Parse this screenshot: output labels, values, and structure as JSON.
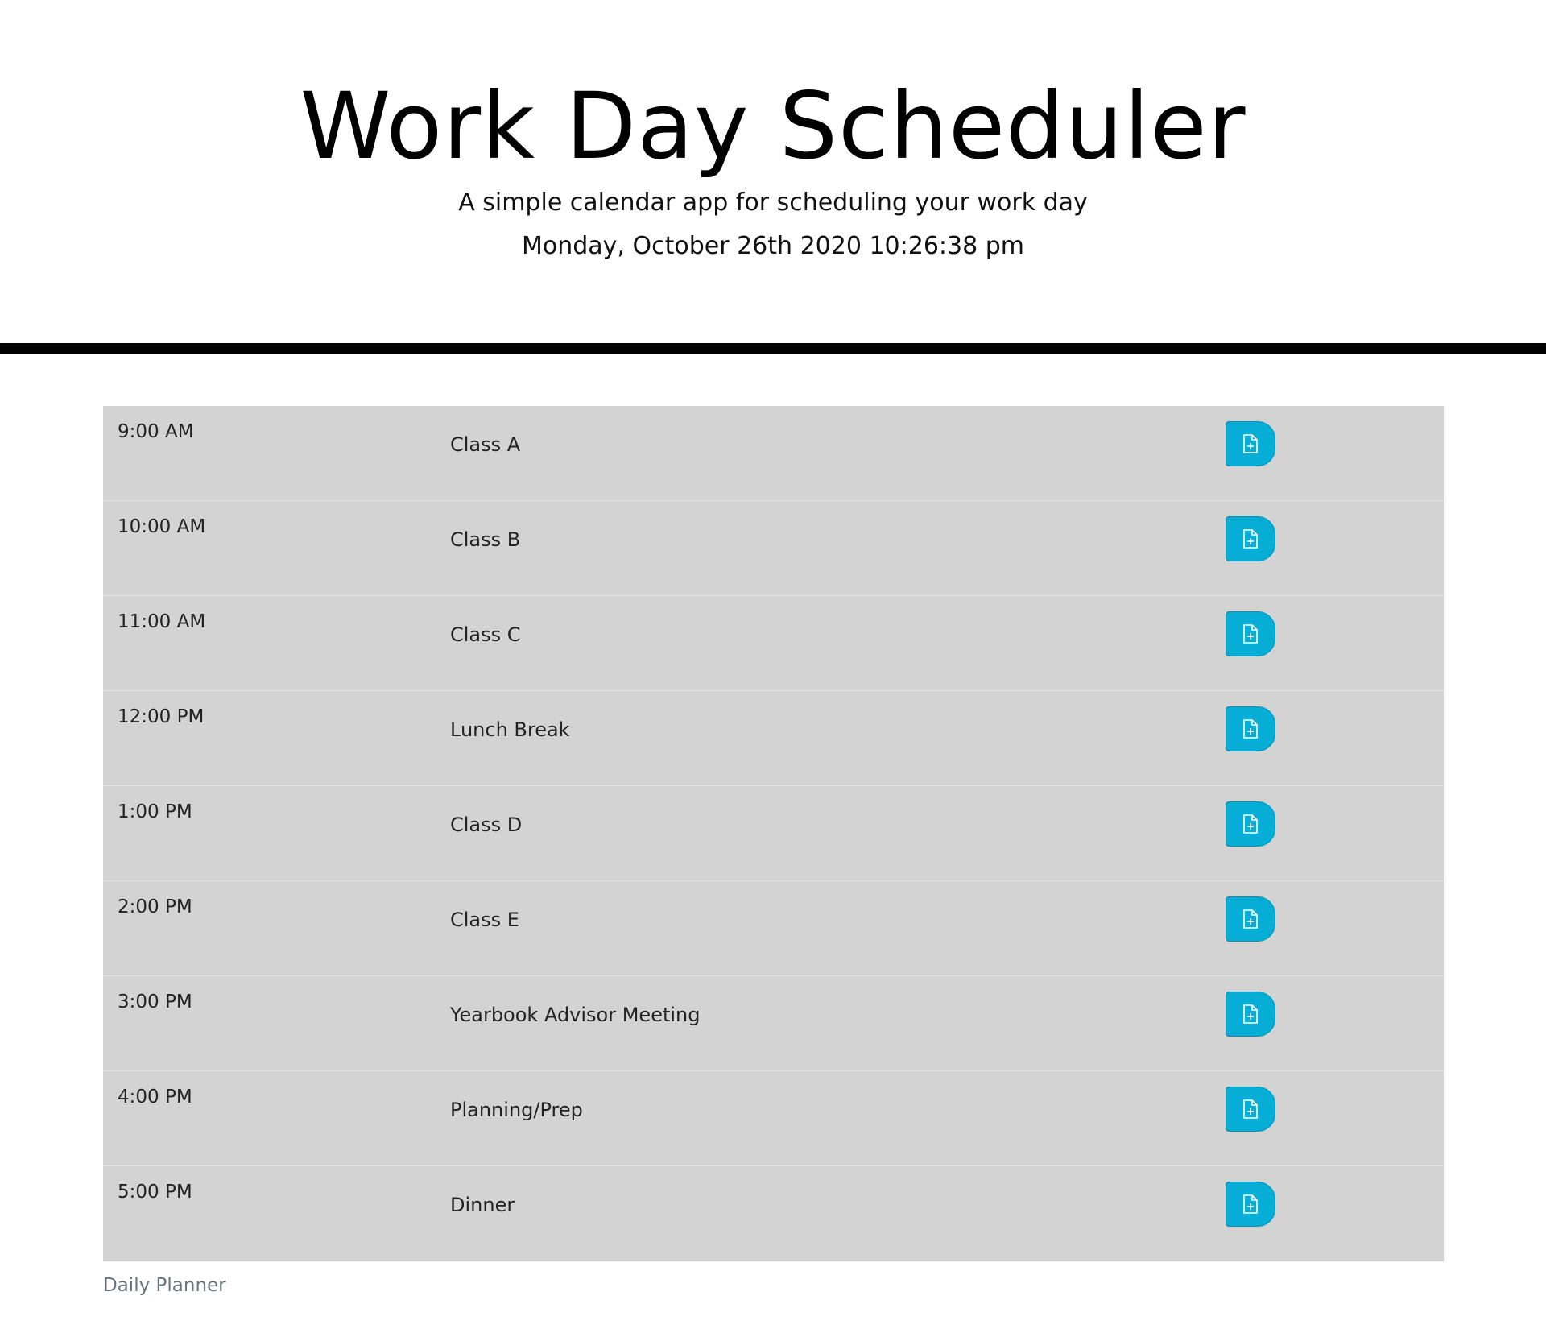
{
  "header": {
    "title": "Work Day Scheduler",
    "subtitle": "A simple calendar app for scheduling your work day",
    "current_datetime": "Monday, October 26th 2020 10:26:38 pm"
  },
  "planner": {
    "caption": "Daily Planner",
    "save_icon": "file-plus-icon",
    "colors": {
      "row_background": "#d3d3d3",
      "save_button": "#06aed5",
      "divider": "#000000"
    },
    "rows": [
      {
        "hour": "9:00 AM",
        "event": "Class A"
      },
      {
        "hour": "10:00 AM",
        "event": "Class B"
      },
      {
        "hour": "11:00 AM",
        "event": "Class C"
      },
      {
        "hour": "12:00 PM",
        "event": "Lunch Break"
      },
      {
        "hour": "1:00 PM",
        "event": "Class D"
      },
      {
        "hour": "2:00 PM",
        "event": "Class E"
      },
      {
        "hour": "3:00 PM",
        "event": "Yearbook Advisor Meeting"
      },
      {
        "hour": "4:00 PM",
        "event": "Planning/Prep"
      },
      {
        "hour": "5:00 PM",
        "event": "Dinner"
      }
    ]
  }
}
